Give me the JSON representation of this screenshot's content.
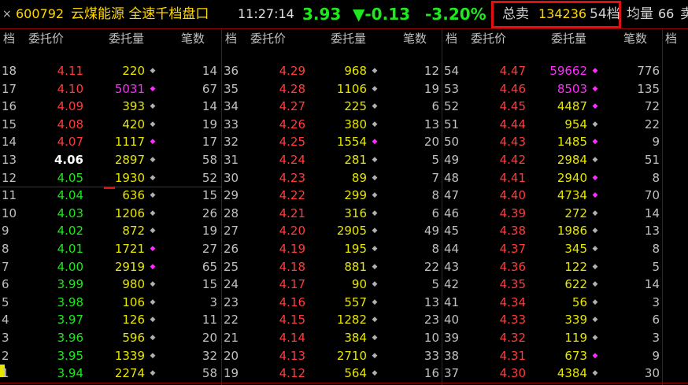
{
  "title_bar": {
    "close_icon": "×",
    "code": "600792",
    "name": "云煤能源 全速千档盘口",
    "time": "11:27:14",
    "price": "3.93",
    "change": "▼-0.13",
    "change_pct": "-3.20%",
    "total_sell_label": "总卖",
    "total_sell_value": "134236",
    "total_sell_levels": "54档",
    "avg_label": "均量",
    "avg_value": "66",
    "avg_extra": "卖"
  },
  "headers": {
    "level": "档",
    "price": "委托价",
    "volume": "委托量",
    "count": "笔数"
  },
  "colors": {
    "up": "#ff3c3c",
    "down": "#1ee81e",
    "flat": "#ffffff",
    "volume": "#e6e600",
    "volume_big": "#ff2bff",
    "border": "#8b0000"
  },
  "columns": [
    {
      "rows": [
        {
          "level": "18",
          "price": "4.11",
          "pc": "red",
          "volume": "220",
          "vc": "yellow",
          "mark": "◆",
          "mc": "gray",
          "count": "14"
        },
        {
          "level": "17",
          "price": "4.10",
          "pc": "red",
          "volume": "5031",
          "vc": "magenta",
          "mark": "◆",
          "mc": "magenta",
          "count": "67"
        },
        {
          "level": "16",
          "price": "4.09",
          "pc": "red",
          "volume": "393",
          "vc": "yellow",
          "mark": "◆",
          "mc": "gray",
          "count": "14"
        },
        {
          "level": "15",
          "price": "4.08",
          "pc": "red",
          "volume": "420",
          "vc": "yellow",
          "mark": "◆",
          "mc": "gray",
          "count": "19"
        },
        {
          "level": "14",
          "price": "4.07",
          "pc": "red",
          "volume": "1117",
          "vc": "yellow",
          "mark": "◆",
          "mc": "magenta",
          "count": "17"
        },
        {
          "level": "13",
          "price": "4.06",
          "pc": "white",
          "volume": "2897",
          "vc": "yellow",
          "mark": "◆",
          "mc": "gray",
          "count": "58"
        },
        {
          "level": "12",
          "price": "4.05",
          "pc": "green",
          "volume": "1930",
          "vc": "yellow",
          "mark": "◆",
          "mc": "gray",
          "count": "52"
        },
        {
          "level": "11",
          "price": "4.04",
          "pc": "green",
          "volume": "636",
          "vc": "yellow",
          "mark": "◆",
          "mc": "gray",
          "count": "15"
        },
        {
          "level": "10",
          "price": "4.03",
          "pc": "green",
          "volume": "1206",
          "vc": "yellow",
          "mark": "◆",
          "mc": "gray",
          "count": "26"
        },
        {
          "level": "9",
          "price": "4.02",
          "pc": "green",
          "volume": "872",
          "vc": "yellow",
          "mark": "◆",
          "mc": "gray",
          "count": "19"
        },
        {
          "level": "8",
          "price": "4.01",
          "pc": "green",
          "volume": "1721",
          "vc": "yellow",
          "mark": "◆",
          "mc": "magenta",
          "count": "27"
        },
        {
          "level": "7",
          "price": "4.00",
          "pc": "green",
          "volume": "2919",
          "vc": "yellow",
          "mark": "◆",
          "mc": "magenta",
          "count": "65"
        },
        {
          "level": "6",
          "price": "3.99",
          "pc": "green",
          "volume": "980",
          "vc": "yellow",
          "mark": "◆",
          "mc": "gray",
          "count": "15"
        },
        {
          "level": "5",
          "price": "3.98",
          "pc": "green",
          "volume": "106",
          "vc": "yellow",
          "mark": "◆",
          "mc": "gray",
          "count": "3"
        },
        {
          "level": "4",
          "price": "3.97",
          "pc": "green",
          "volume": "126",
          "vc": "yellow",
          "mark": "◆",
          "mc": "gray",
          "count": "11"
        },
        {
          "level": "3",
          "price": "3.96",
          "pc": "green",
          "volume": "596",
          "vc": "yellow",
          "mark": "◆",
          "mc": "gray",
          "count": "20"
        },
        {
          "level": "2",
          "price": "3.95",
          "pc": "green",
          "volume": "1339",
          "vc": "yellow",
          "mark": "◆",
          "mc": "gray",
          "count": "32"
        },
        {
          "level": "1",
          "price": "3.94",
          "pc": "green",
          "volume": "2274",
          "vc": "yellow",
          "mark": "◆",
          "mc": "gray",
          "count": "58"
        }
      ]
    },
    {
      "rows": [
        {
          "level": "36",
          "price": "4.29",
          "pc": "red",
          "volume": "968",
          "vc": "yellow",
          "mark": "◆",
          "mc": "gray",
          "count": "12"
        },
        {
          "level": "35",
          "price": "4.28",
          "pc": "red",
          "volume": "1106",
          "vc": "yellow",
          "mark": "◆",
          "mc": "gray",
          "count": "19"
        },
        {
          "level": "34",
          "price": "4.27",
          "pc": "red",
          "volume": "225",
          "vc": "yellow",
          "mark": "◆",
          "mc": "gray",
          "count": "6"
        },
        {
          "level": "33",
          "price": "4.26",
          "pc": "red",
          "volume": "380",
          "vc": "yellow",
          "mark": "◆",
          "mc": "gray",
          "count": "13"
        },
        {
          "level": "32",
          "price": "4.25",
          "pc": "red",
          "volume": "1554",
          "vc": "yellow",
          "mark": "◆",
          "mc": "magenta",
          "count": "20"
        },
        {
          "level": "31",
          "price": "4.24",
          "pc": "red",
          "volume": "281",
          "vc": "yellow",
          "mark": "◆",
          "mc": "gray",
          "count": "5"
        },
        {
          "level": "30",
          "price": "4.23",
          "pc": "red",
          "volume": "89",
          "vc": "yellow",
          "mark": "◆",
          "mc": "gray",
          "count": "7"
        },
        {
          "level": "29",
          "price": "4.22",
          "pc": "red",
          "volume": "299",
          "vc": "yellow",
          "mark": "◆",
          "mc": "gray",
          "count": "8"
        },
        {
          "level": "28",
          "price": "4.21",
          "pc": "red",
          "volume": "316",
          "vc": "yellow",
          "mark": "◆",
          "mc": "gray",
          "count": "6"
        },
        {
          "level": "27",
          "price": "4.20",
          "pc": "red",
          "volume": "2905",
          "vc": "yellow",
          "mark": "◆",
          "mc": "gray",
          "count": "49"
        },
        {
          "level": "26",
          "price": "4.19",
          "pc": "red",
          "volume": "195",
          "vc": "yellow",
          "mark": "◆",
          "mc": "gray",
          "count": "8"
        },
        {
          "level": "25",
          "price": "4.18",
          "pc": "red",
          "volume": "881",
          "vc": "yellow",
          "mark": "◆",
          "mc": "gray",
          "count": "22"
        },
        {
          "level": "24",
          "price": "4.17",
          "pc": "red",
          "volume": "90",
          "vc": "yellow",
          "mark": "◆",
          "mc": "gray",
          "count": "5"
        },
        {
          "level": "23",
          "price": "4.16",
          "pc": "red",
          "volume": "557",
          "vc": "yellow",
          "mark": "◆",
          "mc": "gray",
          "count": "13"
        },
        {
          "level": "22",
          "price": "4.15",
          "pc": "red",
          "volume": "1282",
          "vc": "yellow",
          "mark": "◆",
          "mc": "gray",
          "count": "23"
        },
        {
          "level": "21",
          "price": "4.14",
          "pc": "red",
          "volume": "384",
          "vc": "yellow",
          "mark": "◆",
          "mc": "gray",
          "count": "10"
        },
        {
          "level": "20",
          "price": "4.13",
          "pc": "red",
          "volume": "2710",
          "vc": "yellow",
          "mark": "◆",
          "mc": "gray",
          "count": "33"
        },
        {
          "level": "19",
          "price": "4.12",
          "pc": "red",
          "volume": "564",
          "vc": "yellow",
          "mark": "◆",
          "mc": "gray",
          "count": "16"
        }
      ]
    },
    {
      "rows": [
        {
          "level": "54",
          "price": "4.47",
          "pc": "red",
          "volume": "59662",
          "vc": "magenta",
          "mark": "◆",
          "mc": "magenta",
          "count": "776"
        },
        {
          "level": "53",
          "price": "4.46",
          "pc": "red",
          "volume": "8503",
          "vc": "magenta",
          "mark": "◆",
          "mc": "magenta",
          "count": "135"
        },
        {
          "level": "52",
          "price": "4.45",
          "pc": "red",
          "volume": "4487",
          "vc": "yellow",
          "mark": "◆",
          "mc": "magenta",
          "count": "72"
        },
        {
          "level": "51",
          "price": "4.44",
          "pc": "red",
          "volume": "954",
          "vc": "yellow",
          "mark": "◆",
          "mc": "gray",
          "count": "22"
        },
        {
          "level": "50",
          "price": "4.43",
          "pc": "red",
          "volume": "1485",
          "vc": "yellow",
          "mark": "◆",
          "mc": "magenta",
          "count": "9"
        },
        {
          "level": "49",
          "price": "4.42",
          "pc": "red",
          "volume": "2984",
          "vc": "yellow",
          "mark": "◆",
          "mc": "gray",
          "count": "51"
        },
        {
          "level": "48",
          "price": "4.41",
          "pc": "red",
          "volume": "2940",
          "vc": "yellow",
          "mark": "◆",
          "mc": "magenta",
          "count": "8"
        },
        {
          "level": "47",
          "price": "4.40",
          "pc": "red",
          "volume": "4734",
          "vc": "yellow",
          "mark": "◆",
          "mc": "magenta",
          "count": "70"
        },
        {
          "level": "46",
          "price": "4.39",
          "pc": "red",
          "volume": "272",
          "vc": "yellow",
          "mark": "◆",
          "mc": "gray",
          "count": "14"
        },
        {
          "level": "45",
          "price": "4.38",
          "pc": "red",
          "volume": "1986",
          "vc": "yellow",
          "mark": "◆",
          "mc": "gray",
          "count": "13"
        },
        {
          "level": "44",
          "price": "4.37",
          "pc": "red",
          "volume": "345",
          "vc": "yellow",
          "mark": "◆",
          "mc": "gray",
          "count": "8"
        },
        {
          "level": "43",
          "price": "4.36",
          "pc": "red",
          "volume": "122",
          "vc": "yellow",
          "mark": "◆",
          "mc": "gray",
          "count": "5"
        },
        {
          "level": "42",
          "price": "4.35",
          "pc": "red",
          "volume": "622",
          "vc": "yellow",
          "mark": "◆",
          "mc": "gray",
          "count": "14"
        },
        {
          "level": "41",
          "price": "4.34",
          "pc": "red",
          "volume": "56",
          "vc": "yellow",
          "mark": "◆",
          "mc": "gray",
          "count": "3"
        },
        {
          "level": "40",
          "price": "4.33",
          "pc": "red",
          "volume": "339",
          "vc": "yellow",
          "mark": "◆",
          "mc": "gray",
          "count": "6"
        },
        {
          "level": "39",
          "price": "4.32",
          "pc": "red",
          "volume": "119",
          "vc": "yellow",
          "mark": "◆",
          "mc": "gray",
          "count": "3"
        },
        {
          "level": "38",
          "price": "4.31",
          "pc": "red",
          "volume": "673",
          "vc": "yellow",
          "mark": "◆",
          "mc": "magenta",
          "count": "9"
        },
        {
          "level": "37",
          "price": "4.30",
          "pc": "red",
          "volume": "4384",
          "vc": "yellow",
          "mark": "◆",
          "mc": "gray",
          "count": "30"
        }
      ]
    }
  ]
}
